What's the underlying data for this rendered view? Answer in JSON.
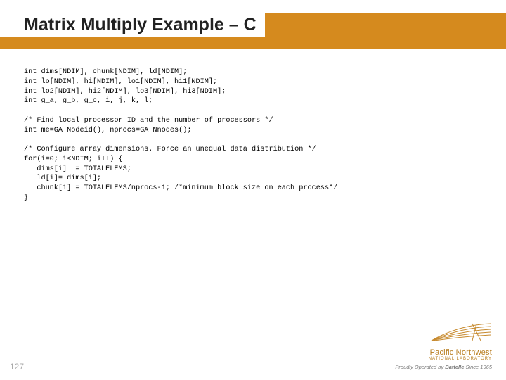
{
  "slide": {
    "title": "Matrix Multiply Example – C",
    "page_number": "127"
  },
  "code": {
    "block1_l1": "int dims[NDIM], chunk[NDIM], ld[NDIM];",
    "block1_l2": "int lo[NDIM], hi[NDIM], lo1[NDIM], hi1[NDIM];",
    "block1_l3": "int lo2[NDIM], hi2[NDIM], lo3[NDIM], hi3[NDIM];",
    "block1_l4": "int g_a, g_b, g_c, i, j, k, l;",
    "block2_l1": "/* Find local processor ID and the number of processors */",
    "block2_l2": "int me=GA_Nodeid(), nprocs=GA_Nnodes();",
    "block3_l1": "/* Configure array dimensions. Force an unequal data distribution */",
    "block3_l2": "for(i=0; i<NDIM; i++) {",
    "block3_l3": "   dims[i]  = TOTALELEMS;",
    "block3_l4": "   ld[i]= dims[i];",
    "block3_l5": "   chunk[i] = TOTALELEMS/nprocs-1; /*minimum block size on each process*/",
    "block3_l6": "}"
  },
  "footer": {
    "lab_name": "Pacific Northwest",
    "lab_sub": "NATIONAL LABORATORY",
    "tagline_prefix": "Proudly Operated by ",
    "tagline_brand": "Battelle",
    "tagline_suffix": " Since 1965"
  }
}
